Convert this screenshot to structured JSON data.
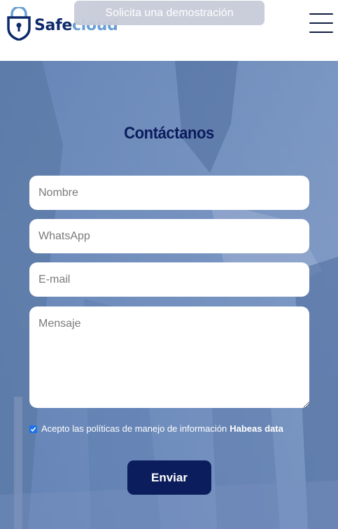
{
  "header": {
    "logo_part1": "Safe",
    "logo_part2": "cloud",
    "demo_button": "Solicita una demostración",
    "menu_icon": "hamburger-icon"
  },
  "form": {
    "title": "Contáctanos",
    "name_placeholder": "Nombre",
    "whatsapp_placeholder": "WhatsApp",
    "email_placeholder": "E-mail",
    "message_placeholder": "Mensaje",
    "consent_text": "Acepto las políticas de manejo de información",
    "consent_link": "Habeas data",
    "consent_checked": true,
    "submit_label": "Enviar"
  },
  "colors": {
    "brand_dark": "#0b1d5c",
    "brand_light": "#6a9fd4",
    "checkbox": "#1a73e8"
  }
}
